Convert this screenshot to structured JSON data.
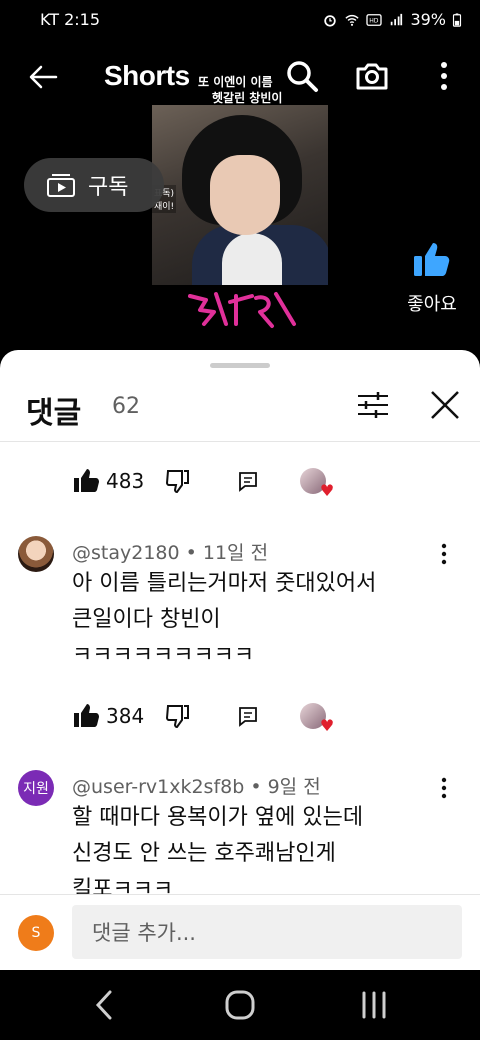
{
  "status_bar": {
    "carrier_time": "KT  2:15",
    "battery": "39%"
  },
  "top_bar": {
    "title": "Shorts",
    "caption_line1": "또 이엔이 이름",
    "caption_line2": "헷갈린 창빈이"
  },
  "video": {
    "subscribe_label": "구독",
    "like_label": "좋아요",
    "subtitle_fragment": "표독)\n재이!"
  },
  "comments": {
    "title": "댓글",
    "count": "62",
    "items": [
      {
        "likes": "483"
      },
      {
        "author": "@stay2180 • 11일 전",
        "text_line1": "아 이름 틀리는거마저 줏대있어서",
        "text_line2": "큰일이다 창빈이",
        "text_line3": "ㅋㅋㅋㅋㅋㅋㅋㅋㅋ",
        "likes": "384"
      },
      {
        "author": "@user-rv1xk2sf8b • 9일 전",
        "avatar_text": "지원",
        "text_line1": "할 때마다 용복이가 옆에 있는데",
        "text_line2": "신경도 안 쓰는 호주쾌남인게",
        "text_line3": "킬포ㅋㅋㅋ"
      }
    ]
  },
  "composer": {
    "avatar_letter": "S",
    "placeholder": "댓글 추가..."
  },
  "colors": {
    "like_blue": "#3ea6ff",
    "heart_red": "#e01f2d",
    "avatar_purple": "#7b2bb5",
    "my_avatar_orange": "#ef7c1a"
  }
}
